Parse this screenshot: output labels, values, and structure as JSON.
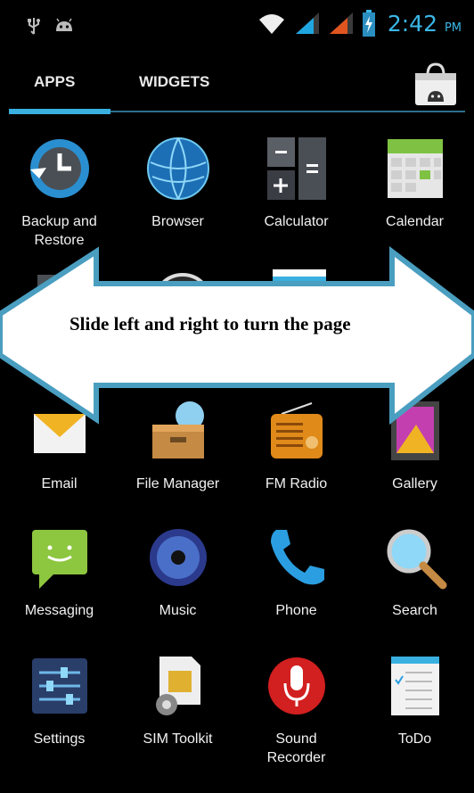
{
  "status_bar": {
    "time": "2:42",
    "ampm": "PM",
    "icons": [
      "usb-icon",
      "android-icon",
      "wifi-icon",
      "signal-icon",
      "signal-icon",
      "battery-icon"
    ]
  },
  "tabs": [
    {
      "label": "APPS",
      "selected": true
    },
    {
      "label": "WIDGETS",
      "selected": false
    }
  ],
  "store_icon": "play-store-icon",
  "apps": [
    {
      "label": "Backup and Restore",
      "label_lines": [
        "Backup and",
        "Restore"
      ],
      "icon": "backup-restore-icon"
    },
    {
      "label": "Browser",
      "label_lines": [
        "Browser"
      ],
      "icon": "browser-icon"
    },
    {
      "label": "Calculator",
      "label_lines": [
        "Calculator"
      ],
      "icon": "calculator-icon"
    },
    {
      "label": "Calendar",
      "label_lines": [
        "Calendar"
      ],
      "icon": "calendar-icon"
    },
    {
      "label": "Email",
      "label_lines": [
        "Email"
      ],
      "icon": "email-icon"
    },
    {
      "label": "File Manager",
      "label_lines": [
        "File Manager"
      ],
      "icon": "file-manager-icon"
    },
    {
      "label": "FM Radio",
      "label_lines": [
        "FM Radio"
      ],
      "icon": "fm-radio-icon"
    },
    {
      "label": "Gallery",
      "label_lines": [
        "Gallery"
      ],
      "icon": "gallery-icon"
    },
    {
      "label": "Messaging",
      "label_lines": [
        "Messaging"
      ],
      "icon": "messaging-icon"
    },
    {
      "label": "Music",
      "label_lines": [
        "Music"
      ],
      "icon": "music-icon"
    },
    {
      "label": "Phone",
      "label_lines": [
        "Phone"
      ],
      "icon": "phone-icon"
    },
    {
      "label": "Search",
      "label_lines": [
        "Search"
      ],
      "icon": "search-icon"
    },
    {
      "label": "Settings",
      "label_lines": [
        "Settings"
      ],
      "icon": "settings-icon"
    },
    {
      "label": "SIM Toolkit",
      "label_lines": [
        "SIM Toolkit"
      ],
      "icon": "sim-toolkit-icon"
    },
    {
      "label": "Sound Recorder",
      "label_lines": [
        "Sound",
        "Recorder"
      ],
      "icon": "sound-recorder-icon"
    },
    {
      "label": "ToDo",
      "label_lines": [
        "ToDo"
      ],
      "icon": "todo-icon"
    }
  ],
  "overlay": {
    "text": "Slide left and right to turn the page",
    "icon": "double-arrow-icon"
  },
  "colors": {
    "accent": "#3ab0e0",
    "arrow_fill": "#ffffff",
    "arrow_stroke": "#4a9ec0",
    "background": "#000000"
  }
}
